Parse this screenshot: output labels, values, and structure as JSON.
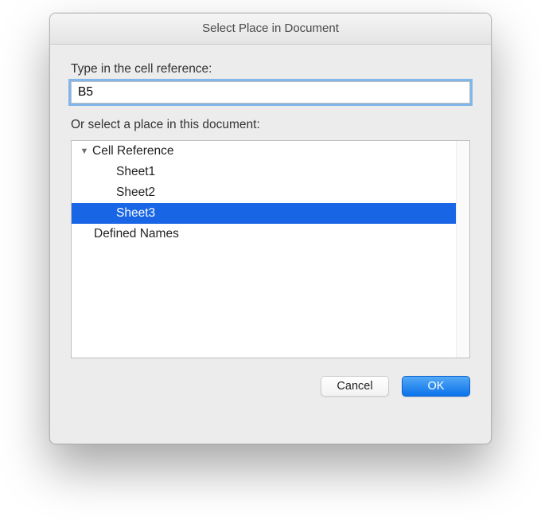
{
  "title": "Select Place in Document",
  "labels": {
    "type_in": "Type in the cell reference:",
    "or_select": "Or select a place in this document:"
  },
  "cell_reference": "B5",
  "tree": {
    "group_label": "Cell Reference",
    "items": [
      "Sheet1",
      "Sheet2",
      "Sheet3"
    ],
    "selected_index": 2,
    "defined_names_label": "Defined Names"
  },
  "buttons": {
    "cancel": "Cancel",
    "ok": "OK"
  }
}
